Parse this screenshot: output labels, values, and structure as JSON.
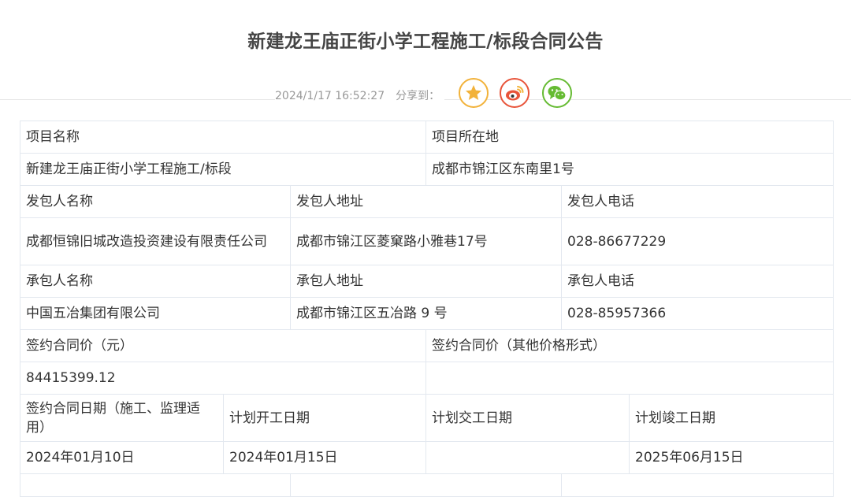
{
  "title": "新建龙王庙正街小学工程施工/标段合同公告",
  "meta": {
    "datetime": "2024/1/17 16:52:27",
    "share_label": "分享到："
  },
  "share_icons": [
    "star-icon",
    "weibo-icon",
    "wechat-icon"
  ],
  "colors": {
    "favorite": "#f2b23a",
    "weibo": "#e8543a",
    "wechat": "#66bb33",
    "border": "#e3e8ef"
  },
  "table": {
    "project_name_label": "项目名称",
    "project_location_label": "项目所在地",
    "project_name": "新建龙王庙正街小学工程施工/标段",
    "project_location": "成都市锦江区东南里1号",
    "issuer_name_label": "发包人名称",
    "issuer_address_label": "发包人地址",
    "issuer_phone_label": "发包人电话",
    "issuer_name": "成都恒锦旧城改造投资建设有限责任公司",
    "issuer_address": "成都市锦江区菱窠路小雅巷17号",
    "issuer_phone": "028-86677229",
    "contractor_name_label": "承包人名称",
    "contractor_address_label": "承包人地址",
    "contractor_phone_label": "承包人电话",
    "contractor_name": "中国五冶集团有限公司",
    "contractor_address": "成都市锦江区五冶路 9 号",
    "contractor_phone": "028-85957366",
    "price_label": "签约合同价（元）",
    "price_other_label": "签约合同价（其他价格形式）",
    "price": "84415399.12",
    "price_other": "",
    "sign_date_label": "签约合同日期（施工、监理适用）",
    "planned_start_label": "计划开工日期",
    "planned_delivery_label": "计划交工日期",
    "planned_completion_label": "计划竣工日期",
    "sign_date": "2024年01月10日",
    "planned_start": "2024年01月15日",
    "planned_delivery": "",
    "planned_completion": "2025年06月15日"
  }
}
